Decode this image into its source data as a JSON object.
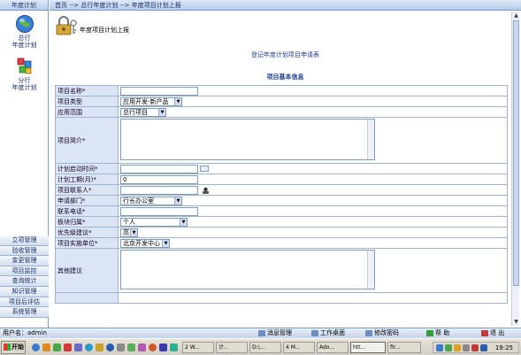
{
  "sidebar": {
    "header": "年度计划",
    "nav_items": [
      {
        "line1": "总行",
        "line2": "年度计划",
        "icon": "globe-icon"
      },
      {
        "line1": "分行",
        "line2": "年度计划",
        "icon": "cubes-icon"
      }
    ],
    "menu": [
      "立项管理",
      "验收管理",
      "变更管理",
      "项目监控",
      "查询统计",
      "知识管理",
      "项目后评估",
      "系统管理"
    ]
  },
  "breadcrumb": "首页 --> 总行年度计划 --> 年度项目计划上报",
  "page_heading": "年度项目计划上报",
  "form_title": "登记年度计划项目申请表",
  "section_title": "项目基本信息",
  "form": {
    "name_label": "项目名称*",
    "name_value": "",
    "type_label": "项目类型",
    "type_value": "应用开发-新产品",
    "scope_label": "应用范围",
    "scope_value": "总行项目",
    "intro_label": "项目简介*",
    "start_label": "计划启动时间*",
    "start_value": "",
    "duration_label": "计划工期(月)*",
    "duration_value": "0",
    "contact_label": "项目联系人*",
    "contact_value": "",
    "dept_label": "申请部门*",
    "dept_value": "行长办公室",
    "phone_label": "联系电话*",
    "phone_value": "",
    "board_label": "板块归属*",
    "board_value": "个人",
    "priority_label": "优先级建议*",
    "priority_value": "高",
    "unit_label": "项目实施单位*",
    "unit_value": "北京开发中心",
    "other_label": "其他建议"
  },
  "status_bar": {
    "user": "用户名：admin",
    "links": [
      "消息管理",
      "工作桌面",
      "修改密码",
      "帮 助",
      "退 出"
    ]
  },
  "taskbar": {
    "start": "开始",
    "items": [
      "2 W...",
      "计...",
      "D:\\...",
      "4 M...",
      "Ado...",
      "htt...",
      "fir..."
    ],
    "clock": "19:25"
  }
}
